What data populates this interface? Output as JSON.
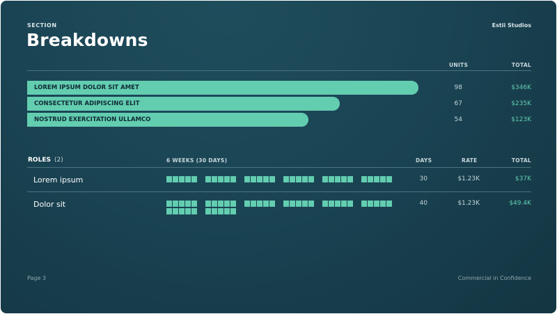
{
  "header": {
    "section_label": "SECTION",
    "title": "Breakdowns",
    "brand": "Estii Studios"
  },
  "breakdown": {
    "columns": {
      "units": "UNITS",
      "total": "TOTAL"
    },
    "max_total_k": 346,
    "items": [
      {
        "label": "LOREM IPSUM DOLOR SIT AMET",
        "units": "98",
        "total": "$346K",
        "total_value_k": 346
      },
      {
        "label": "CONSECTETUR ADIPISCING ELIT",
        "units": "67",
        "total": "$235K",
        "total_value_k": 235
      },
      {
        "label": "NOSTRUD EXERCITATION ULLAMCO",
        "units": "54",
        "total": "$123K",
        "total_value_k": 123
      }
    ]
  },
  "roles": {
    "title": "ROLES",
    "count": "(2)",
    "columns": {
      "timeline": "6 WEEKS (30 DAYS)",
      "days": "DAYS",
      "rate": "RATE",
      "total": "TOTAL"
    },
    "weeks": 6,
    "rows": [
      {
        "name": "Lorem ipsum",
        "days": "30",
        "rate": "$1.23K",
        "total": "$37K",
        "day_count": 30
      },
      {
        "name": "Dolor sit",
        "days": "40",
        "rate": "$1.23K",
        "total": "$49.4K",
        "day_count": 40
      }
    ]
  },
  "colors": {
    "accent": "#63cdb0",
    "background": "#1a4454",
    "muted_text": "#c6d6da"
  },
  "footer": {
    "page": "Page 3",
    "confidentiality": "Commercial in Confidence"
  }
}
